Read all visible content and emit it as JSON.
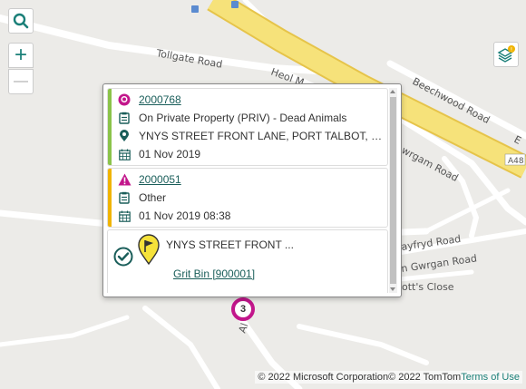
{
  "map": {
    "roads": {
      "tollgate": "Tollgate Road",
      "heol": "Heol M",
      "beechwood": "Beechwood Road",
      "gwrgan": "wrgam Road",
      "a48": "A48",
      "hayfryd": "ayfryd Road",
      "gwrgan2": "n Gwrgan Road",
      "potts": "ott's Close",
      "al": "Al",
      "edge_e": "E"
    },
    "cluster_count": "3",
    "colors": {
      "accent": "#1a7f78",
      "motorway": "#f6e27a",
      "cluster": "#c2168b"
    }
  },
  "controls": {
    "search_icon": "search-icon",
    "zoom_in": "+",
    "zoom_out": "—",
    "layers_icon": "layers-icon"
  },
  "popup": {
    "items": [
      {
        "id": "2000768",
        "color": "#8bc34a",
        "type_icon": "pin-badge-icon",
        "description": "On Private Property (PRIV) - Dead Animals",
        "location": "YNYS STREET FRONT LANE, PORT TALBOT, NEATH",
        "date": "01 Nov 2019"
      },
      {
        "id": "2000051",
        "color": "#f0b400",
        "type_icon": "warning-icon",
        "description": "Other",
        "date": "01 Nov 2019 08:38"
      }
    ],
    "asset": {
      "location": "YNYS STREET FRONT ...",
      "name": "Grit Bin [900001]",
      "extra": "--"
    }
  },
  "attribution": {
    "copyright": "© 2022 Microsoft Corporation© 2022 TomTom",
    "terms": "Terms of Use"
  }
}
